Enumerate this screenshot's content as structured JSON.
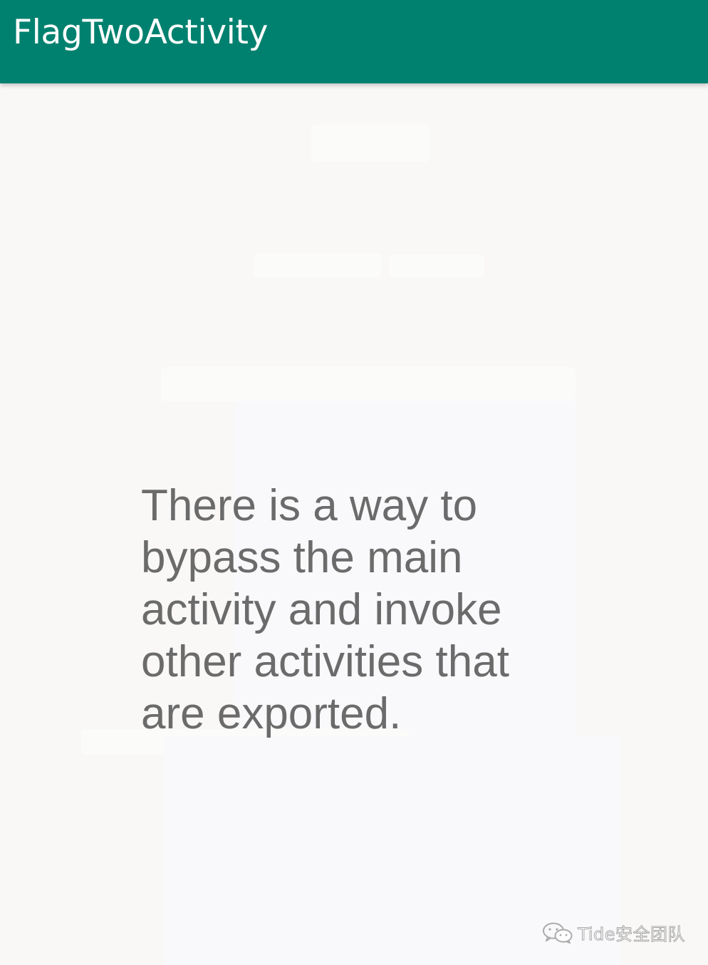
{
  "app_bar": {
    "title": "FlagTwoActivity",
    "background_color": "#00816f",
    "title_color": "#ffffff"
  },
  "main": {
    "message": "There is a way to\nbypass the main\nactivity and invoke\nother activities that\nare exported.",
    "text_color": "#6b6b6b",
    "background_color": "#f9f8f7"
  },
  "watermark": {
    "icon": "wechat-icon",
    "text": "Tide安全团队"
  }
}
